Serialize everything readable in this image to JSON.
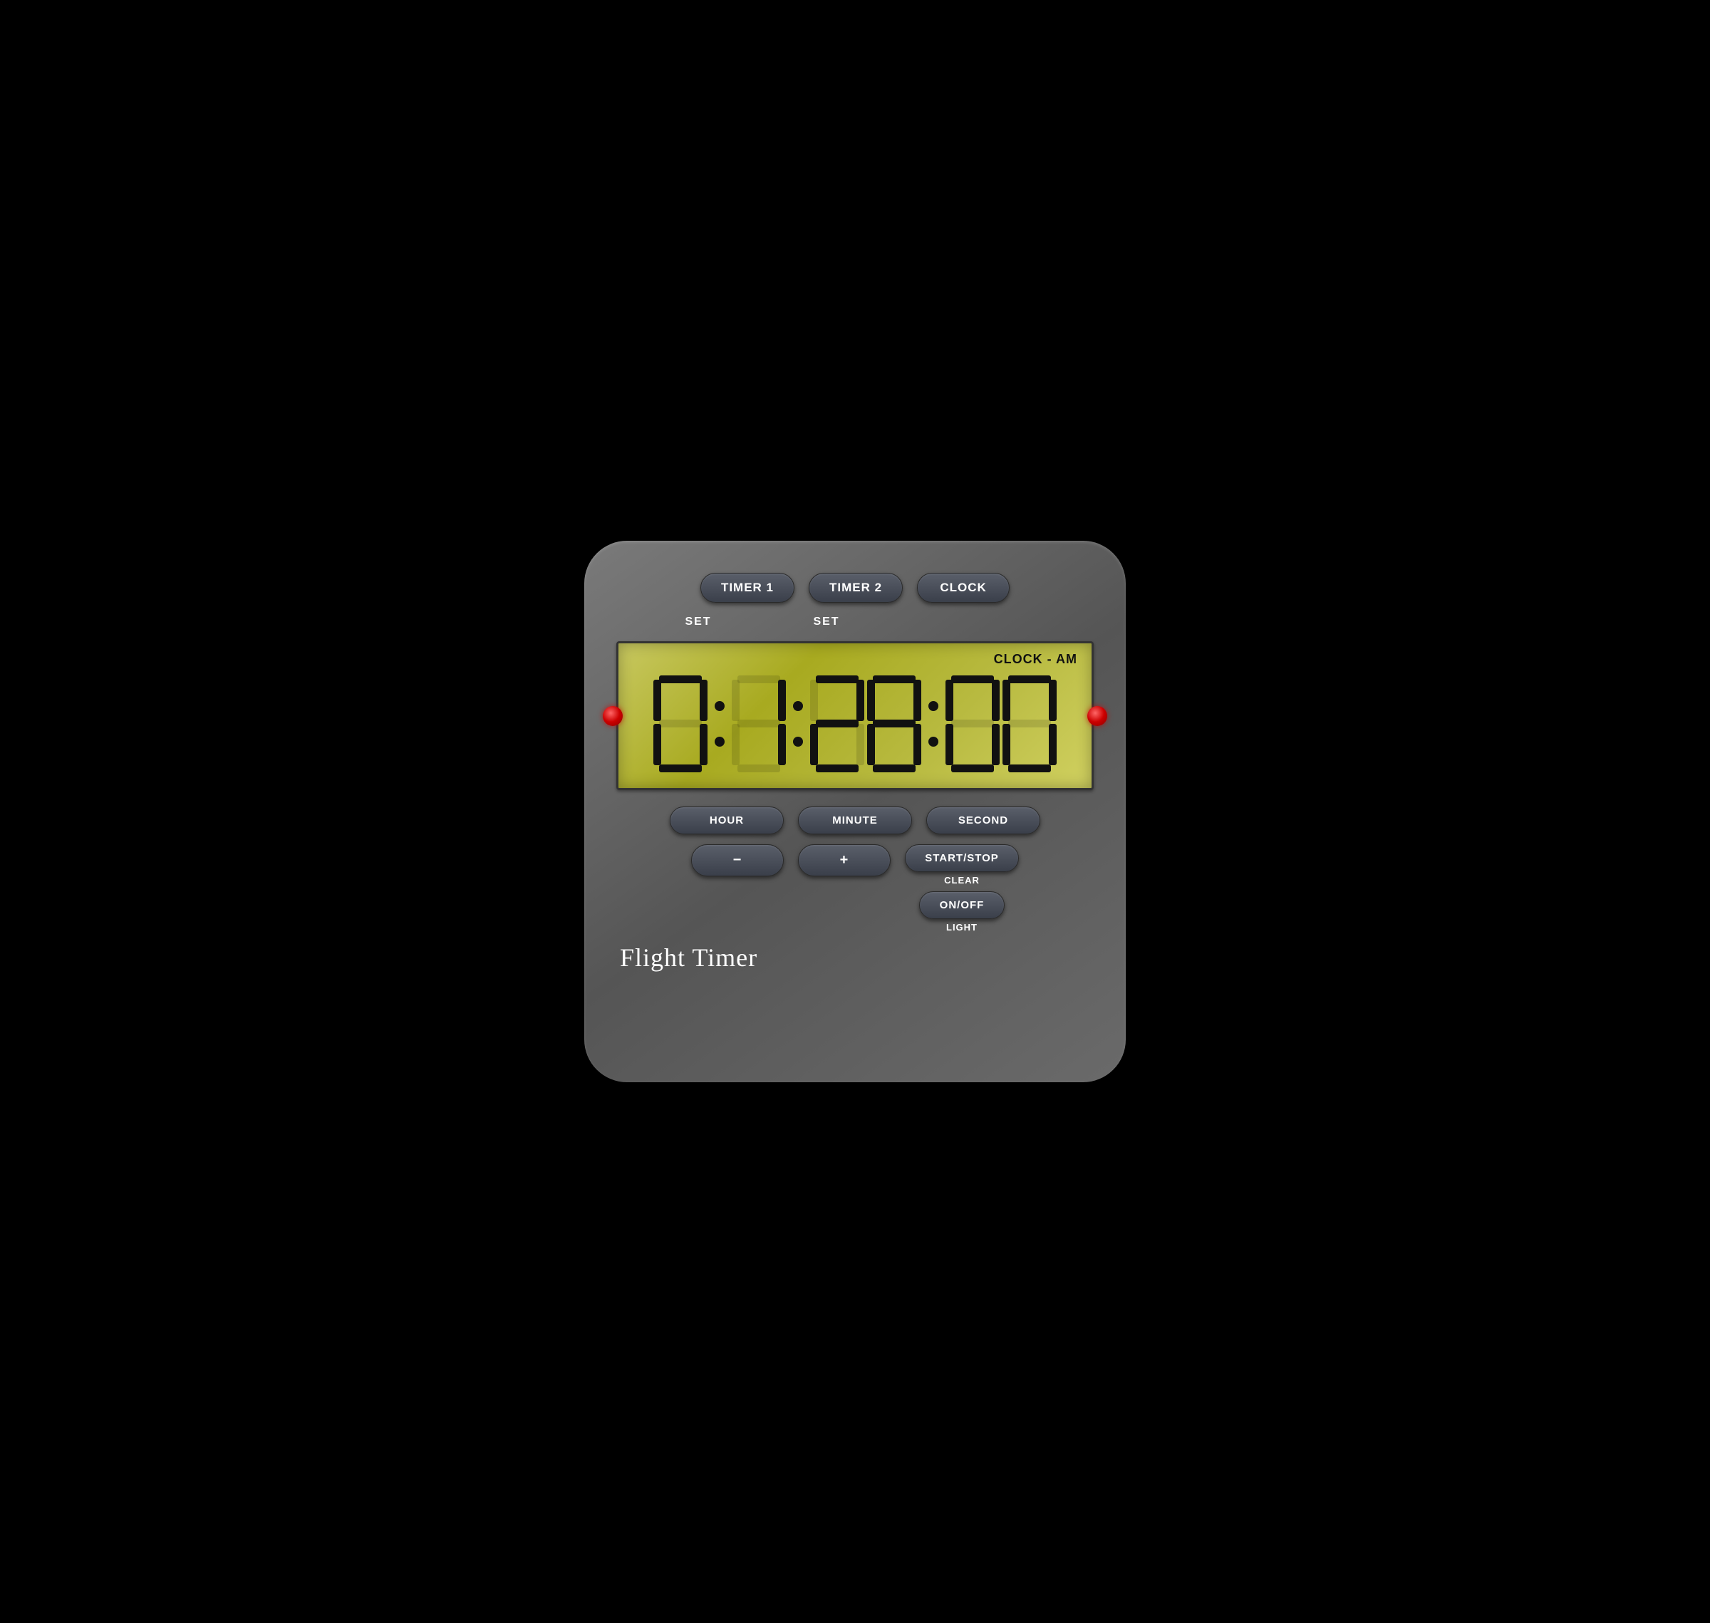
{
  "device": {
    "title": "Flight Timer",
    "display": {
      "mode_label": "CLOCK - AM",
      "time": "01:28:00",
      "digits": [
        "0",
        "1",
        "2",
        "8",
        "0",
        "0"
      ]
    },
    "top_buttons": [
      {
        "label": "TIMER 1",
        "id": "timer1"
      },
      {
        "label": "TIMER 2",
        "id": "timer2"
      },
      {
        "label": "CLOCK",
        "id": "clock"
      }
    ],
    "set_labels": [
      "SET",
      "SET"
    ],
    "bottom_buttons_row1": [
      {
        "label": "HOUR",
        "id": "hour"
      },
      {
        "label": "MINUTE",
        "id": "minute"
      },
      {
        "label": "SECOND",
        "id": "second"
      }
    ],
    "bottom_buttons_row2": [
      {
        "label": "−",
        "id": "minus"
      },
      {
        "label": "+",
        "id": "plus"
      }
    ],
    "right_buttons": [
      {
        "label": "START/STOP",
        "id": "start_stop"
      },
      {
        "label": "CLEAR",
        "id": "clear"
      },
      {
        "label": "ON/OFF",
        "id": "on_off"
      },
      {
        "label": "LIGHT",
        "id": "light"
      }
    ]
  }
}
